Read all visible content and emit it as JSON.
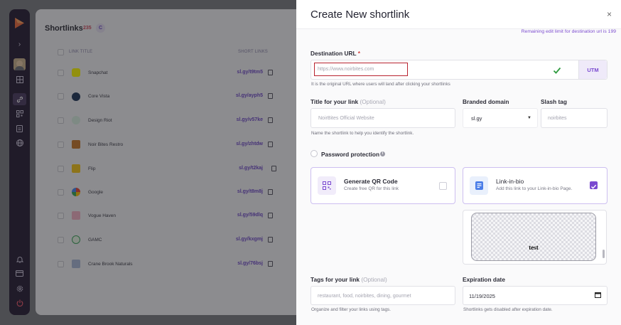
{
  "sidebar": {
    "logo_icon": "brand-logo-icon",
    "expand_icon": "chevron-right-icon",
    "nav_icons": [
      "dashboard-icon",
      "link-icon",
      "qr-code-icon",
      "document-icon",
      "globe-icon"
    ],
    "bottom_icons": [
      "bell-icon",
      "credit-card-icon",
      "gear-icon",
      "power-icon"
    ]
  },
  "background_page": {
    "title": "Shortlinks",
    "count": "235",
    "columns": {
      "title": "LINK TITLE",
      "short": "SHORT LINKS"
    },
    "rows": [
      {
        "title": "Snapchat",
        "link": "sl.gy/t9tm5"
      },
      {
        "title": "Core Vista",
        "link": "sl.gy/ayph5"
      },
      {
        "title": "Design Riot",
        "link": "sl.gy/v57ke"
      },
      {
        "title": "Noir Bites Restro",
        "link": "sl.gy/zhtdw"
      },
      {
        "title": "Flip",
        "link": "sl.gy/t2kaj"
      },
      {
        "title": "Google",
        "link": "sl.gy/t8m8j"
      },
      {
        "title": "Vogue Haven",
        "link": "sl.gy/59dlq"
      },
      {
        "title": "GAMC",
        "link": "sl.gy/kxgmj"
      },
      {
        "title": "Crane Brook Naturals",
        "link": "sl.gy/76bsj"
      }
    ]
  },
  "modal": {
    "title": "Create New shortlink",
    "close_label": "×",
    "remaining_text": "Remaining edit limit for destination url is 199",
    "destination": {
      "label": "Destination URL",
      "required_mark": "*",
      "placeholder": "https://www.noirbites.com",
      "hint": "It is the original URL where users will land after clicking your shortlinks",
      "utm_label": "UTM"
    },
    "title_field": {
      "label": "Title for your link",
      "optional": "(Optional)",
      "placeholder": "NoirBites Official Website",
      "hint": "Name the shortlink to help you identify the shortlink."
    },
    "branded_domain": {
      "label": "Branded domain",
      "value": "sl.gy"
    },
    "slash_tag": {
      "label": "Slash tag",
      "placeholder": "noirbites"
    },
    "password": {
      "label": "Password protection"
    },
    "qr_card": {
      "title": "Generate QR Code",
      "subtitle": "Create free QR for this link",
      "checked": false
    },
    "bio_card": {
      "title": "Link-in-bio",
      "subtitle": "Add this link to your Link-in-bio Page.",
      "checked": true
    },
    "preview_text": "test",
    "tags": {
      "label": "Tags for your link",
      "optional": "(Optional)",
      "placeholder": "restaurant, food, noirbites, dining, gourmet",
      "hint": "Organize and filter your links using tags."
    },
    "expiration": {
      "label": "Expiration date",
      "value": "11/19/2025",
      "hint": "Shortlinks gets disabled after expiration  date."
    }
  },
  "colors": {
    "accent": "#7a49d0",
    "sidebar": "#261b33",
    "error_border": "#b8232f",
    "success": "#2e9b3f"
  }
}
